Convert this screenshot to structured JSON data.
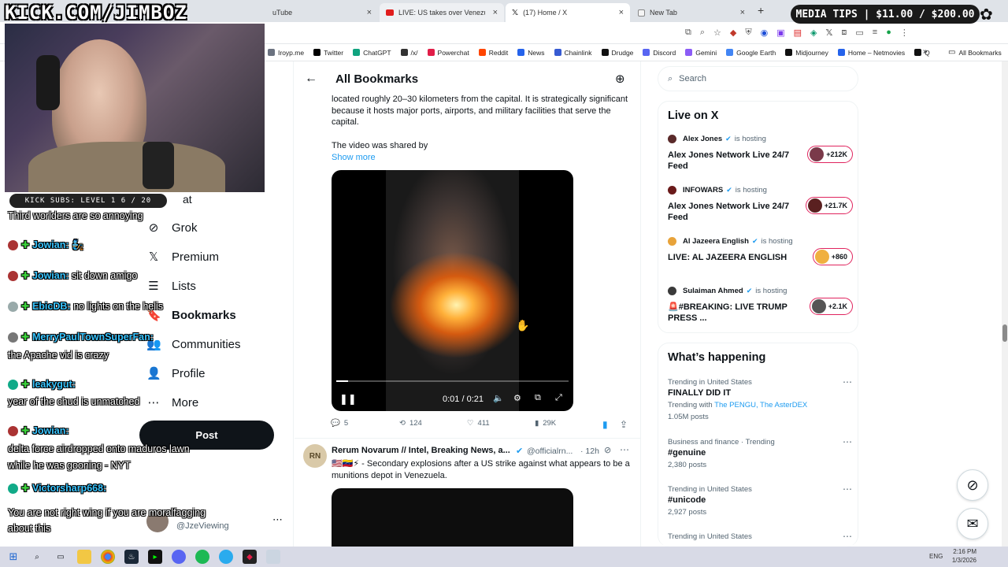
{
  "stream": {
    "url_overlay": "KICK.COM/JIMBOZ",
    "media_tips": "MEDIA TIPS | $11.00 / $200.00",
    "kick_subs": "KICK SUBS: LEVEL 1 6 / 20"
  },
  "browser": {
    "tabs": [
      {
        "label": "uTube"
      },
      {
        "label": "LIVE: US takes over Venezuela a"
      },
      {
        "label": "(17) Home / X"
      },
      {
        "label": "New Tab"
      }
    ],
    "bookmarks": [
      {
        "label": "Iroyp.me",
        "color": "#6b7280"
      },
      {
        "label": "Twitter",
        "color": "#000000"
      },
      {
        "label": "ChatGPT",
        "color": "#10a37f"
      },
      {
        "label": "/x/",
        "color": "#333333"
      },
      {
        "label": "Powerchat",
        "color": "#e11d48"
      },
      {
        "label": "Reddit",
        "color": "#ff4500"
      },
      {
        "label": "News",
        "color": "#2563eb"
      },
      {
        "label": "Chainlink",
        "color": "#375bd2"
      },
      {
        "label": "Drudge",
        "color": "#111111"
      },
      {
        "label": "Discord",
        "color": "#5865f2"
      },
      {
        "label": "Gemini",
        "color": "#8b5cf6"
      },
      {
        "label": "Google Earth",
        "color": "#4285f4"
      },
      {
        "label": "Midjourney",
        "color": "#111111"
      },
      {
        "label": "Home – Netmovies",
        "color": "#2563eb"
      },
      {
        "label": "Q",
        "color": "#111111"
      }
    ],
    "all_bookmarks": "All Bookmarks"
  },
  "sidebar": {
    "chat_partial": "at",
    "items": [
      {
        "label": "Grok",
        "icon": "grok-icon",
        "glyph": "⊘"
      },
      {
        "label": "Premium",
        "icon": "x-logo-icon",
        "glyph": "𝕏"
      },
      {
        "label": "Lists",
        "icon": "lists-icon",
        "glyph": "☰"
      },
      {
        "label": "Bookmarks",
        "icon": "bookmark-icon",
        "glyph": "🔖"
      },
      {
        "label": "Communities",
        "icon": "communities-icon",
        "glyph": "👥"
      },
      {
        "label": "Profile",
        "icon": "profile-icon",
        "glyph": "👤"
      },
      {
        "label": "More",
        "icon": "more-icon",
        "glyph": "⋯"
      }
    ],
    "post_label": "Post",
    "account_handle": "@JzeViewing"
  },
  "chat": [
    {
      "user": "",
      "text": "Third worlders are so annoying"
    },
    {
      "user": "Jowian:",
      "text": "🧞"
    },
    {
      "user": "Jowian:",
      "text": "sit down amigo"
    },
    {
      "user": "EbicDB:",
      "text": "no lights on the helis"
    },
    {
      "user": "MerryPaulTownSuperFan:",
      "text": ""
    },
    {
      "user": "",
      "text": "the Apache vid is crazy"
    },
    {
      "user": "leakygut:",
      "text": ""
    },
    {
      "user": "",
      "text": "year of the chud is unmatched"
    },
    {
      "user": "Jowian:",
      "text": ""
    },
    {
      "user": "",
      "text": "delta force airdropped onto maduros lawn"
    },
    {
      "user": "",
      "text": "while he was gooning - NYT"
    },
    {
      "user": "Victorsharp668:",
      "text": ""
    },
    {
      "user": "",
      "text": "You are not right wing if you are moralfagging"
    },
    {
      "user": "",
      "text": "about this"
    }
  ],
  "center": {
    "header_title": "All Bookmarks",
    "post1": {
      "text": "located roughly 20–30 kilometers from the capital. It is strategically significant because it hosts major ports, airports, and military facilities that serve the capital.",
      "text2": "The video was shared by",
      "show_more": "Show more",
      "video_time": "0:01 / 0:21",
      "video_progress": 0.05,
      "replies": "5",
      "reposts": "124",
      "likes": "411",
      "views": "29K"
    },
    "post2": {
      "author": "Rerum Novarum // Intel, Breaking News, a...",
      "handle": "@officialrn...",
      "time": "· 12h",
      "avatar": "RN",
      "text": "🇺🇸🇻🇪⚡ - Secondary explosions after a US strike against what appears to be a munitions depot in Venezuela."
    }
  },
  "right": {
    "search_placeholder": "Search",
    "live_title": "Live on X",
    "live": [
      {
        "host": "Alex Jones",
        "status": "is hosting",
        "title": "Alex Jones Network Live 24/7 Feed",
        "count": "+212K"
      },
      {
        "host": "INFOWARS",
        "status": "is hosting",
        "title": "Alex Jones Network Live 24/7 Feed",
        "count": "+21.7K"
      },
      {
        "host": "Al Jazeera English",
        "status": "is hosting",
        "title": "LIVE: AL JAZEERA ENGLISH",
        "count": "+860"
      },
      {
        "host": "Sulaiman Ahmed",
        "status": "is hosting",
        "title": "🚨#BREAKING: LIVE TRUMP PRESS ...",
        "count": "+2.1K"
      }
    ],
    "happening_title": "What’s happening",
    "trends": [
      {
        "meta": "Trending in United States",
        "name": "FINALLY DID IT",
        "extra_prefix": "Trending with ",
        "extra_links": "The PENGU, The AsterDEX",
        "posts": "1.05M posts"
      },
      {
        "meta": "Business and finance · Trending",
        "name": "#genuine",
        "extra_prefix": "",
        "extra_links": "",
        "posts": "2,380 posts"
      },
      {
        "meta": "Trending in United States",
        "name": "#unicode",
        "extra_prefix": "",
        "extra_links": "",
        "posts": "2,927 posts"
      },
      {
        "meta": "Trending in United States",
        "name": "",
        "extra_prefix": "",
        "extra_links": "",
        "posts": ""
      }
    ]
  },
  "taskbar": {
    "lang": "ENG",
    "time": "2:16 PM",
    "date": "1/3/2026"
  }
}
